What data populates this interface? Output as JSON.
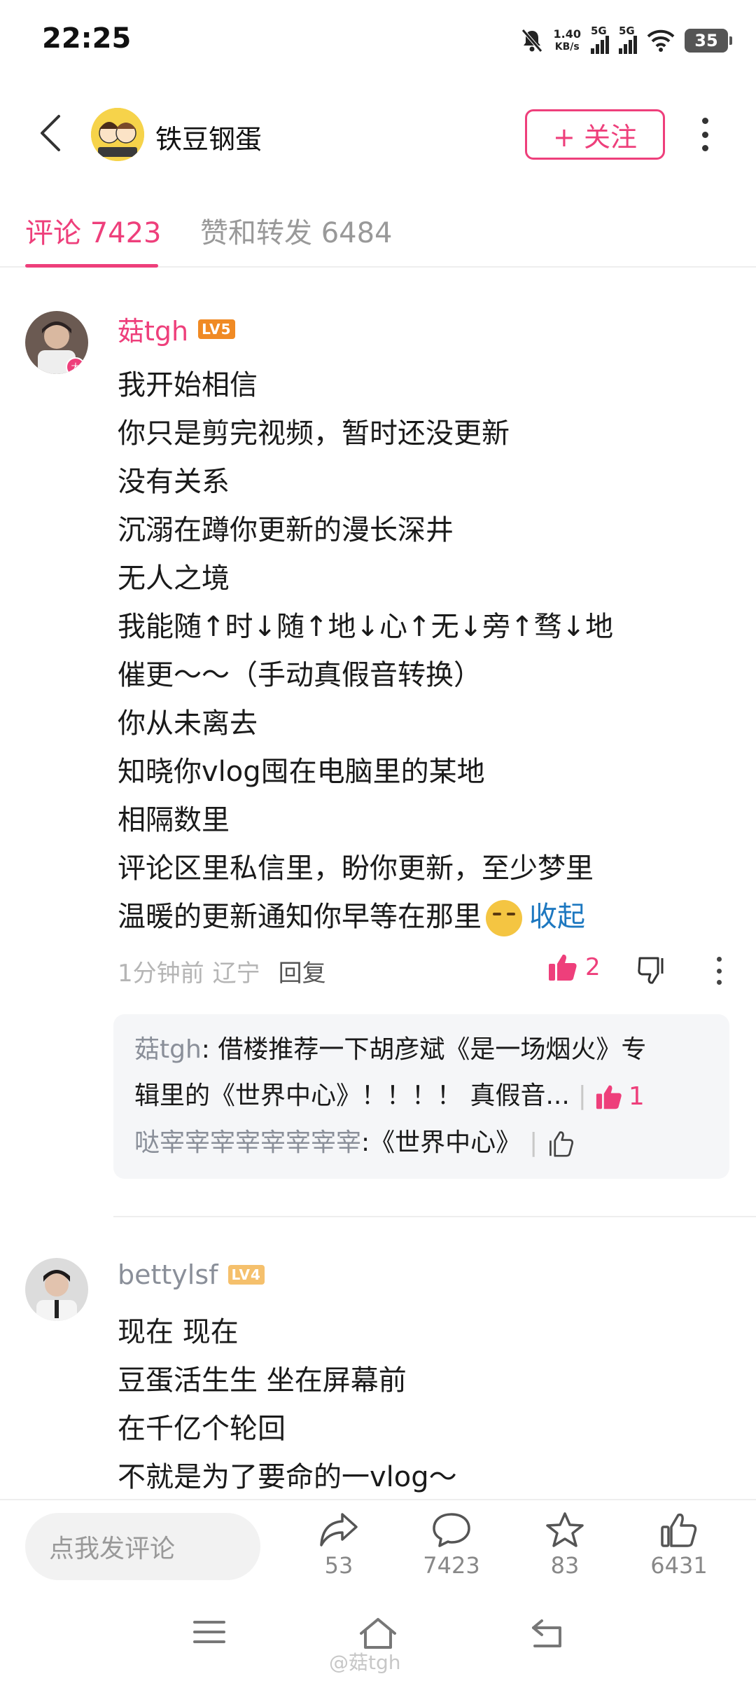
{
  "status_bar": {
    "time": "22:25",
    "net_speed_value": "1.40",
    "net_speed_unit": "KB/s",
    "signal1_label": "5G",
    "signal2_label": "5G",
    "battery": "35"
  },
  "header": {
    "title": "铁豆钢蛋",
    "follow_label": "+ 关注"
  },
  "tabs": [
    {
      "label": "评论 7423",
      "active": true
    },
    {
      "label": "赞和转发 6484",
      "active": false
    }
  ],
  "comments": [
    {
      "username": "菇tgh",
      "level": "LV5",
      "username_color": "#ee3f7b",
      "lines": [
        "我开始相信",
        "你只是剪完视频，暂时还没更新",
        "没有关系",
        "沉溺在蹲你更新的漫长深井",
        "无人之境",
        "我能随↑时↓随↑地↓心↑无↓旁↑骛↓地",
        "催更～～（手动真假音转换）",
        "你从未离去",
        "知晓你vlog囤在电脑里的某地",
        "相隔数里",
        "评论区里私信里，盼你更新，至少梦里",
        "温暖的更新通知你早等在那里"
      ],
      "collapse_label": "收起",
      "time": "1分钟前",
      "location": "辽宁",
      "reply_label": "回复",
      "likes": "2",
      "replies": [
        {
          "name": "菇tgh",
          "text_line1": ": 借楼推荐一下胡彦斌《是一场烟火》专",
          "text_line2": "辑里的《世界中心》！！！！ 真假音...",
          "likes": "1"
        },
        {
          "name": "哒宰宰宰宰宰宰宰宰",
          "text": ":《世界中心》",
          "likes": ""
        }
      ]
    },
    {
      "username": "bettylsf",
      "level": "LV4",
      "username_color": "#8a8f99",
      "lines": [
        "现在 现在",
        "豆蛋活生生 坐在屏幕前",
        "在千亿个轮回",
        "不就是为了要命的一vlog～"
      ]
    }
  ],
  "bottom_bar": {
    "input_placeholder": "点我发评论",
    "share_count": "53",
    "comment_count": "7423",
    "favorite_count": "83",
    "like_count": "6431"
  },
  "watermark": "@菇tgh",
  "colors": {
    "accent": "#ee3f7b",
    "link": "#1d78c0"
  }
}
